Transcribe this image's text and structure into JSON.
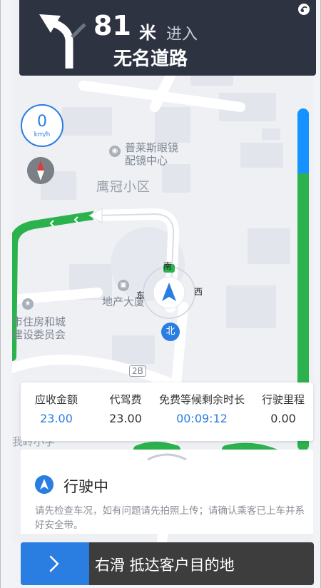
{
  "navigation": {
    "distance": "81",
    "unit": "米",
    "action": "进入",
    "road_name": "无名道路",
    "maneuver_icon": "turn-left-arrow-icon"
  },
  "speed": {
    "value": "0",
    "unit": "km/h"
  },
  "map": {
    "district": "鹰冠小区",
    "poi_1": [
      "普莱斯眼镜",
      "配镜中心"
    ],
    "poi_2": "地产大厦",
    "poi_3": [
      "市住房和城",
      "建设委员会"
    ],
    "road_label": "2B",
    "bottom_text": "我岭小学",
    "compass_labels": {
      "n": "南",
      "e": "西",
      "w": "东",
      "s": "北"
    },
    "compass_n_badge": "北"
  },
  "route_progress": {
    "completed_fraction": 0.19,
    "completed_color": "#1592ff",
    "remaining_color": "#2bb24c"
  },
  "fare": {
    "receivable_label": "应收金额",
    "receivable_value": "23.00",
    "driver_fee_label": "代驾费",
    "driver_fee_value": "23.00",
    "free_wait_label": "免费等候剩余时长",
    "free_wait_value": "00:09:12",
    "mileage_label": "行驶里程",
    "mileage_value": "0.00"
  },
  "status": {
    "title": "行驶中",
    "notice": "请先检查车况，如有问题请先拍照上传；请确认乘客已上车并系好安全带。"
  },
  "slide_button": {
    "text": "右滑  抵达客户目的地"
  },
  "colors": {
    "accent": "#2a7de1",
    "nav_bg": "#2d3340",
    "route_green": "#2bb24c",
    "slide_bg": "#3d3d3d"
  }
}
